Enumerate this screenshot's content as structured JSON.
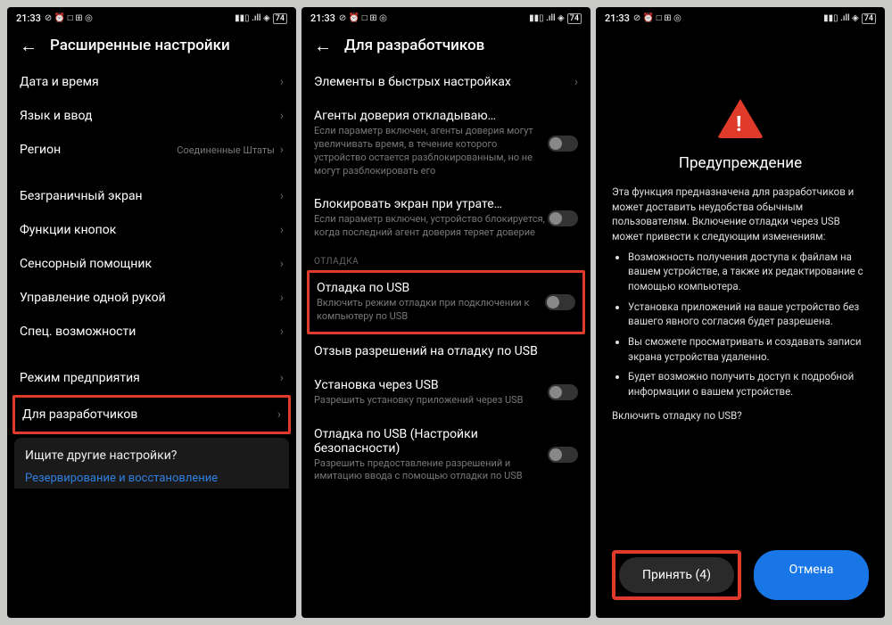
{
  "phone1": {
    "time": "21:33",
    "status_icons": "⊘ ⏰ □ ⊞ ◎",
    "signal": "▮▮▯ .ıll ◈",
    "battery": "74",
    "header": "Расширенные настройки",
    "rows": {
      "datetime": "Дата и время",
      "lang": "Язык и ввод",
      "region_label": "Регион",
      "region_value": "Соединенные Штаты",
      "fullscreen": "Безграничный экран",
      "buttons": "Функции кнопок",
      "touch": "Сенсорный помощник",
      "onehand": "Управление одной рукой",
      "accessibility": "Спец. возможности",
      "enterprise": "Режим предприятия",
      "dev": "Для разработчиков"
    },
    "footer": {
      "q": "Ищите другие настройки?",
      "link": "Резервирование и восстановление"
    }
  },
  "phone2": {
    "time": "21:33",
    "status_icons": "⊘ ⏰ □ ⊞ ◎",
    "signal": "▮▮▯ .ıll ◈",
    "battery": "74",
    "header": "Для разработчиков",
    "rows": {
      "quick": "Элементы в быстрых настройках",
      "trust_title": "Агенты доверия откладываю…",
      "trust_sub": "Если параметр включен, агенты доверия могут увеличивать время, в течение которого устройство остается разблокированным, но не могут разблокировать его",
      "lock_title": "Блокировать экран при утрате…",
      "lock_sub": "Если параметр включен, устройство блокируется, когда последний агент доверия теряет доверие",
      "section": "ОТЛАДКА",
      "usb_title": "Отладка по USB",
      "usb_sub": "Включить режим отладки при подключении к компьютеру по USB",
      "revoke": "Отзыв разрешений на отладку по USB",
      "install_title": "Установка через USB",
      "install_sub": "Разрешить установку приложений через USB",
      "sec_title": "Отладка по USB (Настройки безопасности)",
      "sec_sub": "Разрешить предоставление разрешений и имитацию ввода с помощью отладки по USB"
    }
  },
  "phone3": {
    "time": "21:33",
    "status_icons": "⊘ ⏰ □ ⊞ ◎",
    "signal": "▮▮▯ .ıll ◈",
    "battery": "74",
    "title": "Предупреждение",
    "intro": "Эта функция предназначена для разработчиков и может доставить неудобства обычным пользователям. Включение отладки через USB может привести к следующим изменениям:",
    "bullets": {
      "b0": "Возможность получения доступа к файлам на вашем устройстве, а также их редактирование с помощью компьютера.",
      "b1": "Установка приложений на ваше устройство без вашего явного согласия будет разрешена.",
      "b2": "Вы сможете просматривать и создавать записи экрана устройства удаленно.",
      "b3": "Будет возможно получить доступ к подробной информации о вашем устройстве."
    },
    "prompt": "Включить отладку по USB?",
    "accept": "Принять (4)",
    "cancel": "Отмена"
  }
}
